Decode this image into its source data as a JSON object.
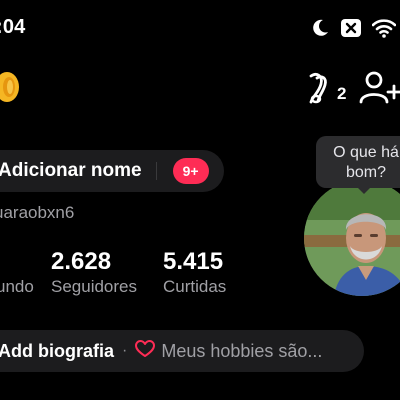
{
  "status_bar": {
    "time": ":04",
    "icons": [
      "moon-icon",
      "notification-blocked-icon",
      "wifi-icon"
    ]
  },
  "header": {
    "coin_icon": "coin-icon",
    "friends_icon": "friends-icon",
    "friends_count": "2",
    "add_user_icon": "add-user-icon"
  },
  "profile": {
    "add_name_label": "Adicionar nome",
    "notifications_badge": "9+",
    "username": "uaraobxn6",
    "stats": [
      {
        "value": "",
        "label": "undo"
      },
      {
        "value": "2.628",
        "label": "Seguidores"
      },
      {
        "value": "5.415",
        "label": "Curtidas"
      }
    ],
    "bio": {
      "add_label": "Add biografia",
      "separator": "·",
      "hobbies_prompt": "Meus hobbies são..."
    },
    "avatar_tooltip_line1": "O que há",
    "avatar_tooltip_line2": "bom?"
  },
  "colors": {
    "background": "#000000",
    "pill_bg": "#1c1c1e",
    "badge": "#fe2c55",
    "secondary_text": "#a0a0a5"
  }
}
